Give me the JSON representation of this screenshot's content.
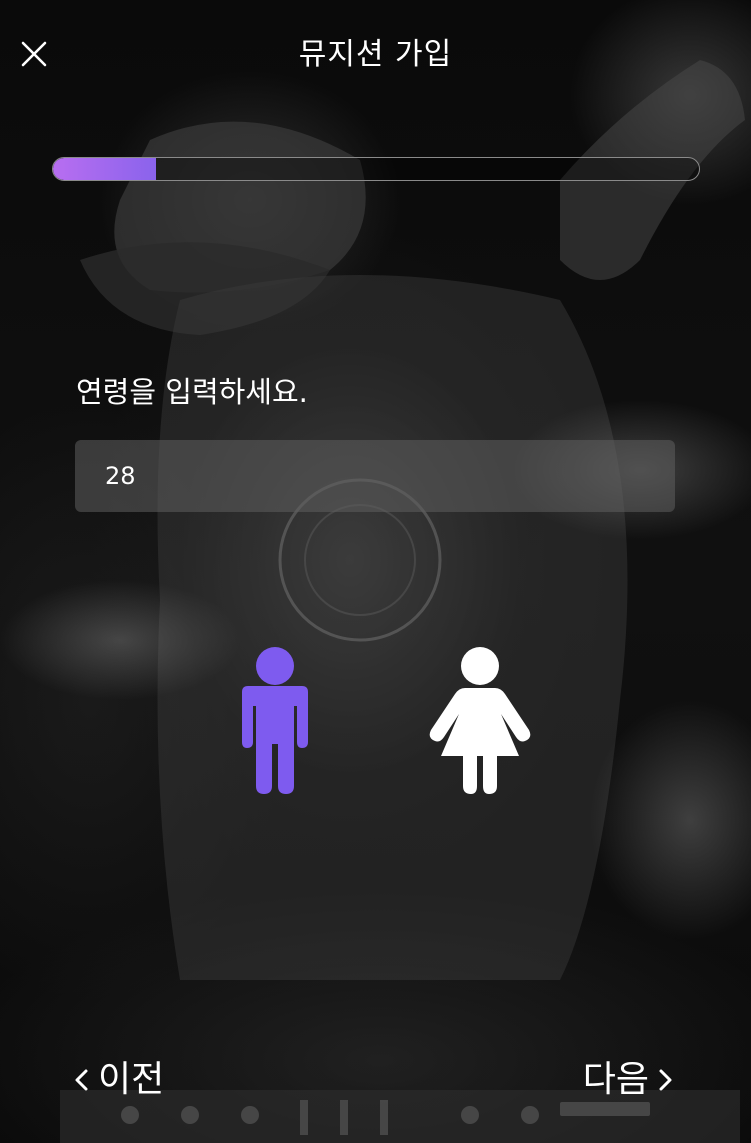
{
  "header": {
    "title": "뮤지션 가입",
    "close_icon": "close-icon"
  },
  "progress": {
    "fraction": 0.16,
    "fill_color_start": "#b86ef0",
    "fill_color_end": "#8a63ec"
  },
  "form": {
    "prompt": "연령을 입력하세요.",
    "age_value": "28"
  },
  "gender": {
    "selected": "male",
    "options": [
      {
        "id": "male",
        "icon": "male-icon",
        "color": "#7e5bef"
      },
      {
        "id": "female",
        "icon": "female-icon",
        "color": "#ffffff"
      }
    ]
  },
  "footer": {
    "prev_label": "이전",
    "next_label": "다음",
    "prev_icon": "chevron-left-icon",
    "next_icon": "chevron-right-icon"
  }
}
